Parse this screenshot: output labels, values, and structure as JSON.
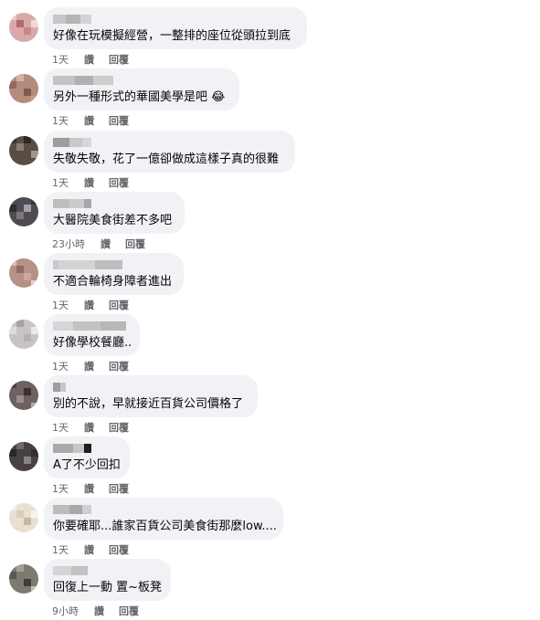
{
  "comments": [
    {
      "text": "好像在玩模擬經營，一整排的座位從頭拉到底",
      "time": "1天",
      "like": "讚",
      "reply": "回覆"
    },
    {
      "text": "另外一種形式的華國美學是吧 😂",
      "time": "1天",
      "like": "讚",
      "reply": "回覆"
    },
    {
      "text": "失敬失敬，花了一億卻做成這樣子真的很難",
      "time": "1天",
      "like": "讚",
      "reply": "回覆"
    },
    {
      "text": "大醫院美食街差不多吧",
      "time": "23小時",
      "like": "讚",
      "reply": "回覆"
    },
    {
      "text": "不適合輪椅身障者進出",
      "time": "1天",
      "like": "讚",
      "reply": "回覆"
    },
    {
      "text": "好像學校餐廳..",
      "time": "1天",
      "like": "讚",
      "reply": "回覆"
    },
    {
      "text": "別的不說，早就接近百貨公司價格了",
      "time": "1天",
      "like": "讚",
      "reply": "回覆"
    },
    {
      "text": "A了不少回扣",
      "time": "1天",
      "like": "讚",
      "reply": "回覆"
    },
    {
      "text": "你要確耶...誰家百貨公司美食街那麼low....",
      "time": "1天",
      "like": "讚",
      "reply": "回覆"
    },
    {
      "text": "回復上一動 置~板凳",
      "time": "9小時",
      "like": "讚",
      "reply": "回覆"
    }
  ]
}
